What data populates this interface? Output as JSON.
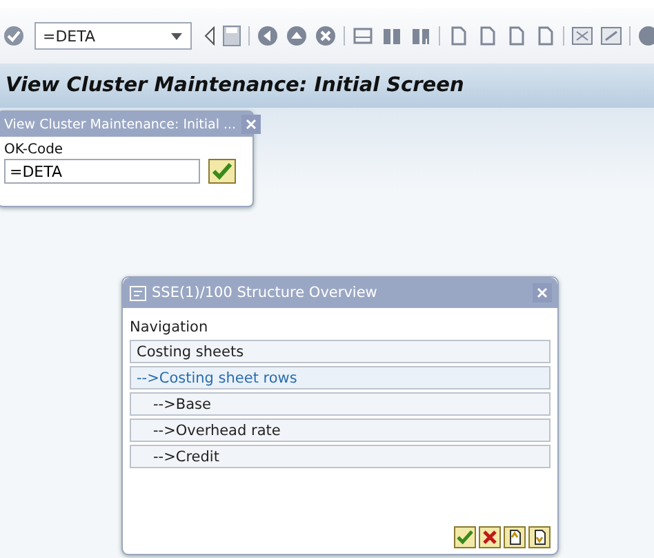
{
  "toolbar": {
    "command_field": "=DETA"
  },
  "page_title": "View Cluster Maintenance: Initial Screen",
  "okcode_dialog": {
    "title": "View Cluster Maintenance: Initial ...",
    "label": "OK-Code",
    "value": "=DETA"
  },
  "structure_dialog": {
    "title": "SSE(1)/100 Structure Overview",
    "section": "Navigation",
    "tree": [
      {
        "label": "Costing sheets",
        "selected": false,
        "children": [
          {
            "label": "-->Costing sheet rows",
            "selected": true,
            "children": [
              {
                "label": "-->Base",
                "selected": false
              },
              {
                "label": "-->Overhead rate",
                "selected": false
              },
              {
                "label": "-->Credit",
                "selected": false
              }
            ]
          }
        ]
      }
    ]
  }
}
